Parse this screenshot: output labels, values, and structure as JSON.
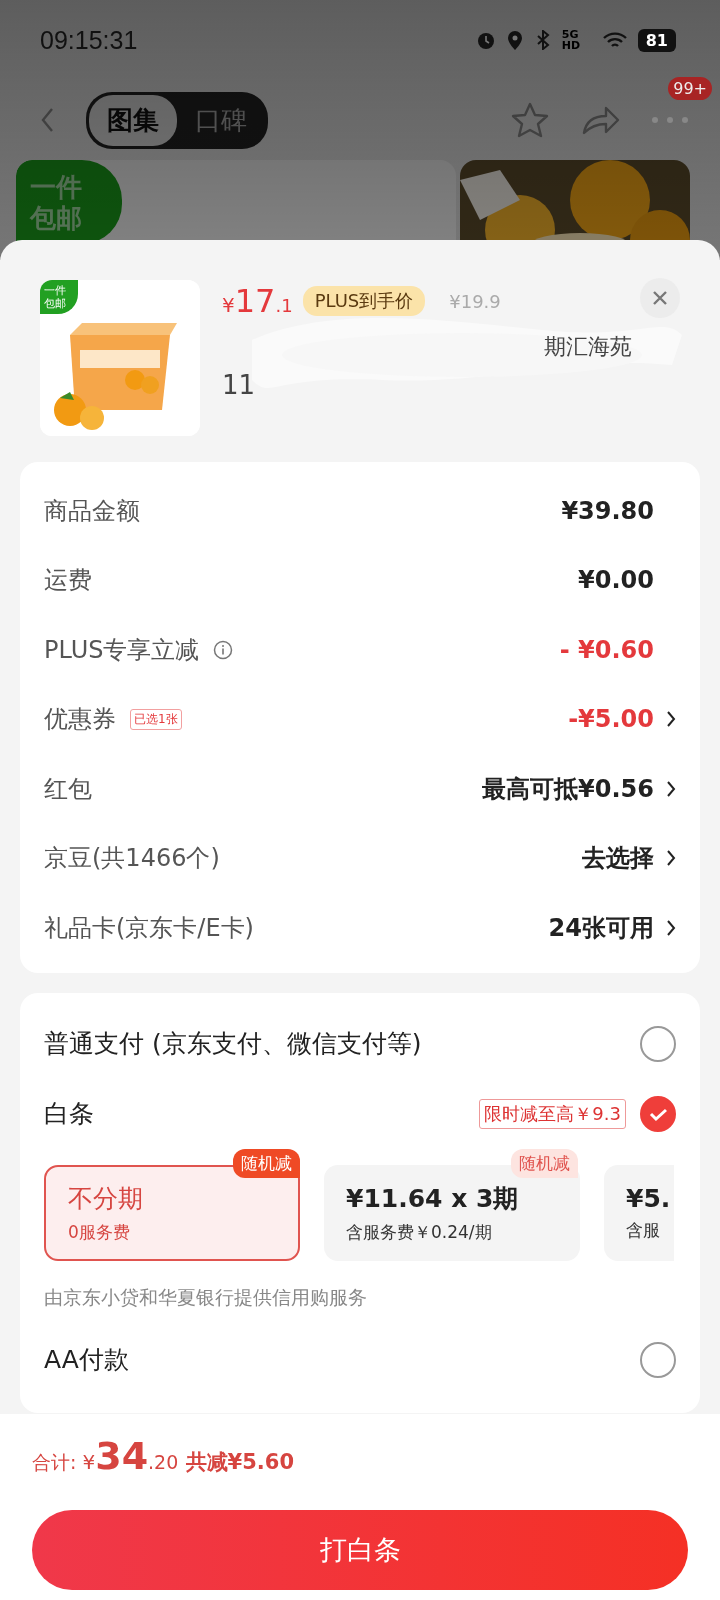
{
  "status_bar": {
    "time": "09:15:31",
    "network": "5G HD",
    "battery": "81"
  },
  "nav": {
    "tabs": [
      {
        "label": "图集",
        "selected": true
      },
      {
        "label": "口碑",
        "selected": false
      }
    ],
    "badge": "99+"
  },
  "background": {
    "promo_tag": [
      "一件",
      "包邮"
    ]
  },
  "product": {
    "badge": [
      "一件",
      "包邮"
    ],
    "currency": "¥",
    "price_main": "17",
    "price_decimal": ".1",
    "price_tag": "PLUS到手价",
    "original_price": "¥19.9",
    "title_line_1": "期汇海苑",
    "title_line_2": "11"
  },
  "fees": [
    {
      "label": "商品金额",
      "value": "¥39.80",
      "kind": "plain",
      "arrow": false
    },
    {
      "label": "运费",
      "value": "¥0.00",
      "kind": "plain",
      "arrow": false
    },
    {
      "label": "PLUS专享立减",
      "value": "- ¥0.60",
      "kind": "discount",
      "arrow": false,
      "info": true
    },
    {
      "label": "优惠券",
      "tag": "已选1张",
      "value": "-¥5.00",
      "kind": "discount",
      "arrow": true
    },
    {
      "label": "红包",
      "value": "最高可抵¥0.56",
      "kind": "plain",
      "arrow": true
    },
    {
      "label": "京豆(共1466个)",
      "value": "去选择",
      "kind": "plain",
      "arrow": true
    },
    {
      "label": "礼品卡(京东卡/E卡)",
      "value": "24张可用",
      "kind": "plain",
      "arrow": true
    }
  ],
  "payment": {
    "options": [
      {
        "label": "普通支付 (京东支付、微信支付等)",
        "selected": false
      },
      {
        "label": "白条",
        "promo": "限时减至高￥9.3",
        "selected": true
      }
    ],
    "plans": [
      {
        "title": "不分期",
        "subtitle": "0服务费",
        "badge": "随机减",
        "selected": true
      },
      {
        "title": "¥11.64 x 3期",
        "subtitle": "含服务费￥0.24/期",
        "badge": "随机减",
        "selected": false
      },
      {
        "title": "¥5.",
        "subtitle": "含服",
        "selected": false
      }
    ],
    "note": "由京东小贷和华夏银行提供信用购服务",
    "extra_option": {
      "label": "AA付款",
      "selected": false
    }
  },
  "footer": {
    "total_label": "合计:",
    "currency": "¥",
    "total_main": "34",
    "total_decimal": ".20",
    "saving": "共减¥5.60",
    "button": "打白条"
  }
}
